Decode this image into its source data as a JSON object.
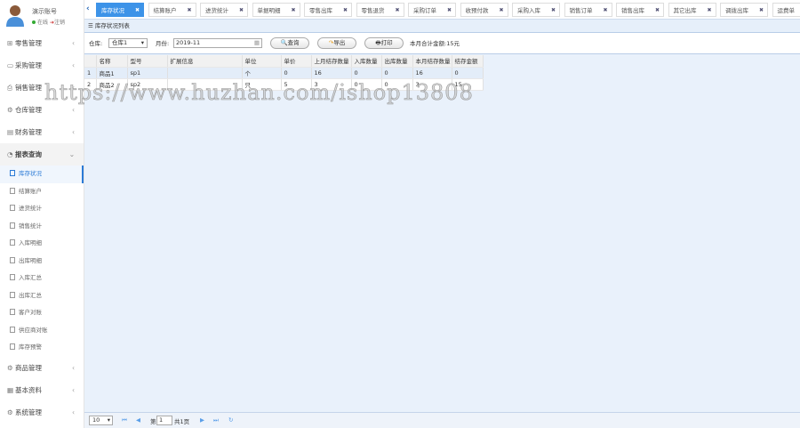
{
  "user": {
    "name": "演示账号",
    "status": "在线",
    "logout": "注销"
  },
  "menu_top": [
    "零售管理",
    "采购管理",
    "销售管理",
    "仓库管理",
    "财务管理"
  ],
  "menu_open": "报表查询",
  "submenu": [
    "库存状况",
    "结算账户",
    "进货统计",
    "销售统计",
    "入库明细",
    "出库明细",
    "入库汇总",
    "出库汇总",
    "客户对账",
    "供应商对账",
    "库存预警"
  ],
  "menu_bottom": [
    "商品管理",
    "基本资料",
    "系统管理"
  ],
  "tabs": [
    "库存状况",
    "结算账户",
    "进货统计",
    "单据明细",
    "零售出库",
    "零售退货",
    "采购订单",
    "收预付款",
    "采购入库",
    "销售订单",
    "销售出库",
    "其它出库",
    "调拨出库",
    "运费单"
  ],
  "panel_title": "库存状况列表",
  "toolbar": {
    "warehouse_label": "仓库:",
    "warehouse_value": "仓库1",
    "month_label": "月份:",
    "month_value": "2019-11",
    "query": "查询",
    "export": "导出",
    "print": "打印",
    "total": "本月合计金额:15元"
  },
  "table": {
    "headers": [
      "名称",
      "型号",
      "扩展信息",
      "单位",
      "单价",
      "上月结存数量",
      "入库数量",
      "出库数量",
      "本月结存数量",
      "结存金额"
    ],
    "rows": [
      [
        "1",
        "商品1",
        "sp1",
        "",
        "个",
        "0",
        "16",
        "0",
        "0",
        "16",
        "0"
      ],
      [
        "2",
        "商品2",
        "sp2",
        "",
        "只",
        "5",
        "3",
        "0",
        "0",
        "3",
        "15"
      ]
    ]
  },
  "footer": {
    "page_size": "10",
    "page_prefix": "第",
    "page": "1",
    "page_suffix": "共1页"
  },
  "watermark": "https://www.huzhan.com/ishop13808"
}
